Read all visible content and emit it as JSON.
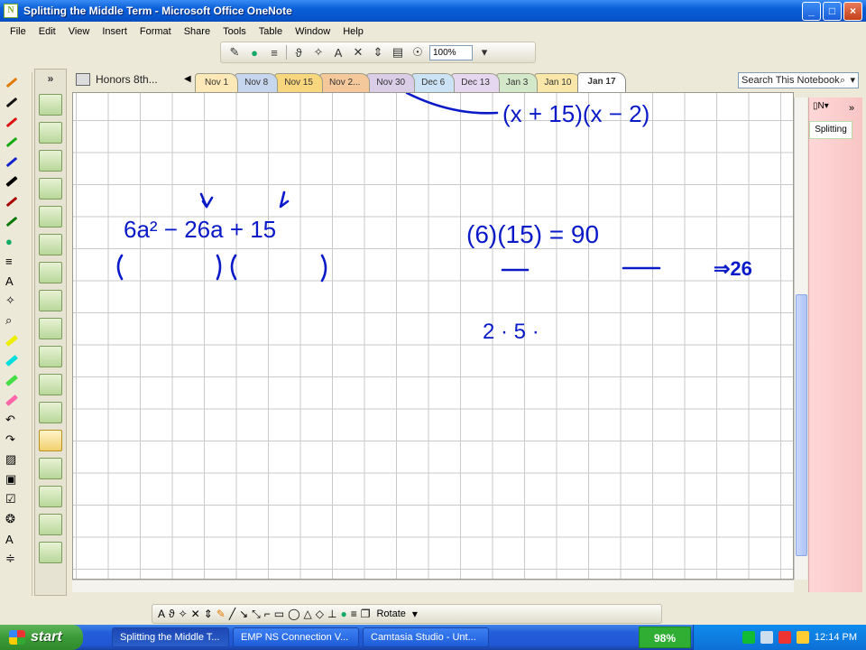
{
  "window": {
    "title": "Splitting the Middle Term - Microsoft Office OneNote",
    "minimize": "_",
    "maximize": "□",
    "close": "×"
  },
  "menu": [
    "File",
    "Edit",
    "View",
    "Insert",
    "Format",
    "Share",
    "Tools",
    "Table",
    "Window",
    "Help"
  ],
  "toolbar": {
    "zoom": "100%"
  },
  "notebook": {
    "name": "Honors 8th..."
  },
  "tabs": [
    {
      "label": "Nov 1",
      "color": "#fde9b7"
    },
    {
      "label": "Nov 8",
      "color": "#c7d6ef"
    },
    {
      "label": "Nov 15",
      "color": "#f8d67d"
    },
    {
      "label": "Nov 2...",
      "color": "#f5c89c"
    },
    {
      "label": "Nov 30",
      "color": "#d9cde7"
    },
    {
      "label": "Dec 6",
      "color": "#cbe3f5"
    },
    {
      "label": "Dec 13",
      "color": "#e6d7f0"
    },
    {
      "label": "Jan 3",
      "color": "#d2e8c8"
    },
    {
      "label": "Jan 10",
      "color": "#f8e7a9"
    },
    {
      "label": "Jan 17",
      "color": "#ffffff"
    }
  ],
  "search": {
    "placeholder": "Search This Notebook"
  },
  "page": {
    "tab_label": "Splitting",
    "ink": {
      "top_factors": "(x + 15)(x − 2)",
      "expression": "6a² − 26a + 15",
      "product": "(6)(15) = 90",
      "target": "⇒26",
      "factors_hint": "2 · 5 ·"
    }
  },
  "drawbar": {
    "rotate": "Rotate"
  },
  "taskbar": {
    "start": "start",
    "tasks": [
      "Splitting the Middle T...",
      "EMP NS Connection V...",
      "Camtasia Studio - Unt..."
    ],
    "battery": "98%",
    "clock": "12:14 PM"
  },
  "colors": {
    "ink": "#0a1ac8",
    "canvas_grid": "#c9c9c9"
  }
}
